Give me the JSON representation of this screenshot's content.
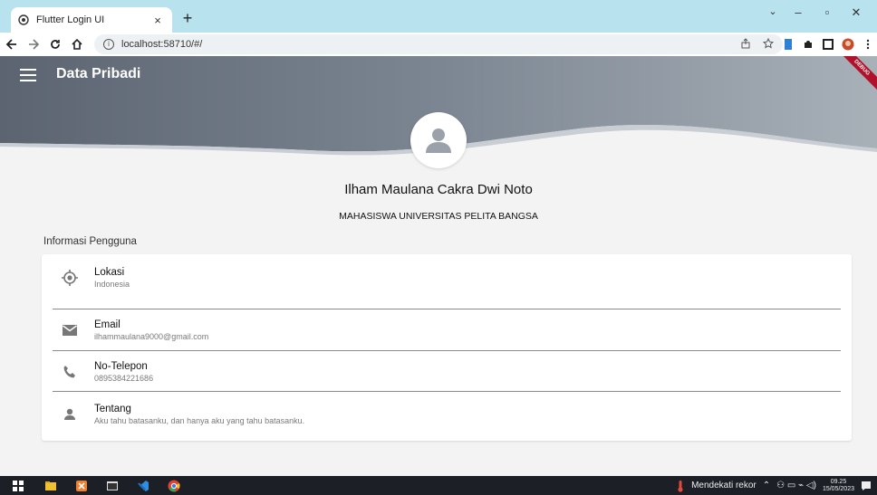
{
  "browser": {
    "tab_title": "Flutter Login UI",
    "tab_close": "×",
    "new_tab": "+",
    "url": "localhost:58710/#/",
    "win_minimize": "–",
    "win_restore": "▫",
    "win_close": "✕",
    "chevron": "⌄"
  },
  "app": {
    "title": "Data Pribadi",
    "debug_label": "DEBUG",
    "accent_color": "#6d7885"
  },
  "profile": {
    "name": "Ilham Maulana Cakra Dwi Noto",
    "subtitle": "MAHASISWA UNIVERSITAS PELITA BANGSA",
    "section_label": "Informasi Pengguna",
    "items": [
      {
        "title": "Lokasi",
        "value": "Indonesia",
        "icon": "location-icon"
      },
      {
        "title": "Email",
        "value": "ilhammaulana9000@gmail.com",
        "icon": "email-icon"
      },
      {
        "title": "No-Telepon",
        "value": "0895384221686",
        "icon": "phone-icon"
      },
      {
        "title": "Tentang",
        "value": "Aku tahu batasanku, dan hanya aku yang tahu batasanku.",
        "icon": "person-icon"
      }
    ]
  },
  "taskbar": {
    "weather_text": "Mendekati rekor",
    "time": "09.25",
    "date": "15/05/2023"
  }
}
